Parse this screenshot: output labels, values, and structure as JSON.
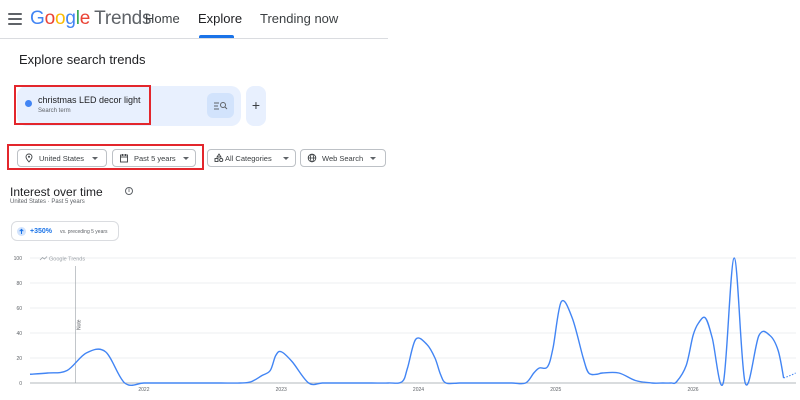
{
  "header": {
    "logo": {
      "g1": "G",
      "g2": "o",
      "g3": "o",
      "g4": "g",
      "g5": "l",
      "g6": "e",
      "product": "Trends"
    },
    "tabs": [
      {
        "label": "Home",
        "active": false
      },
      {
        "label": "Explore",
        "active": true
      },
      {
        "label": "Trending now",
        "active": false
      }
    ]
  },
  "page_title": "Explore search trends",
  "search_term": {
    "text": "christmas LED decor light",
    "type": "Search term",
    "color": "#4285f4"
  },
  "add_button": "+",
  "filters": {
    "region": "United States",
    "period": "Past 5 years",
    "category": "All Categories",
    "property": "Web Search"
  },
  "interest": {
    "title": "Interest over time",
    "subtitle": "United States · Past 5 years",
    "change_value": "+350%",
    "change_note": "vs. preceding 5 years"
  },
  "chart_data": {
    "type": "line",
    "watermark": "Google Trends",
    "note_label": "Note",
    "ylim": [
      0,
      100
    ],
    "yticks": [
      "0",
      "20",
      "40",
      "60",
      "80",
      "100"
    ],
    "xticks": [
      "2022",
      "2023",
      "2024",
      "2025",
      "2026"
    ],
    "line_color": "#4285f4",
    "series": [
      {
        "x": [
          2021.17,
          2021.3,
          2021.44,
          2021.58,
          2021.72,
          2021.86,
          2022.0,
          2022.14,
          2022.28,
          2022.42,
          2022.56,
          2022.7,
          2022.78,
          2022.86,
          2022.92,
          2022.96,
          2023.0,
          2023.08,
          2023.2,
          2023.3,
          2023.42,
          2023.54,
          2023.66,
          2023.78,
          2023.88,
          2023.92,
          2023.98,
          2024.06,
          2024.12,
          2024.16,
          2024.2,
          2024.3,
          2024.42,
          2024.54,
          2024.68,
          2024.78,
          2024.84,
          2024.88,
          2024.94,
          2024.98,
          2025.04,
          2025.12,
          2025.2,
          2025.24,
          2025.3,
          2025.34,
          2025.46,
          2025.58,
          2025.7,
          2025.78,
          2025.84,
          2025.88,
          2025.95,
          2026.0,
          2026.04,
          2026.09,
          2026.14,
          2026.22,
          2026.3,
          2026.38,
          2026.48,
          2026.56,
          2026.62,
          2026.66
        ],
        "y": [
          7,
          8,
          10,
          24,
          25,
          0,
          0,
          0,
          0,
          0,
          0,
          0,
          1,
          6,
          10,
          22,
          25,
          17,
          0,
          0,
          0,
          0,
          0,
          0,
          1,
          12,
          35,
          31,
          20,
          7,
          0,
          0,
          0,
          0,
          0,
          0,
          8,
          12,
          13,
          28,
          65,
          52,
          20,
          8,
          7,
          8,
          8,
          2,
          0,
          0,
          0,
          1,
          14,
          38,
          48,
          52,
          36,
          0,
          100,
          0,
          38,
          38,
          26,
          4
        ]
      }
    ]
  }
}
